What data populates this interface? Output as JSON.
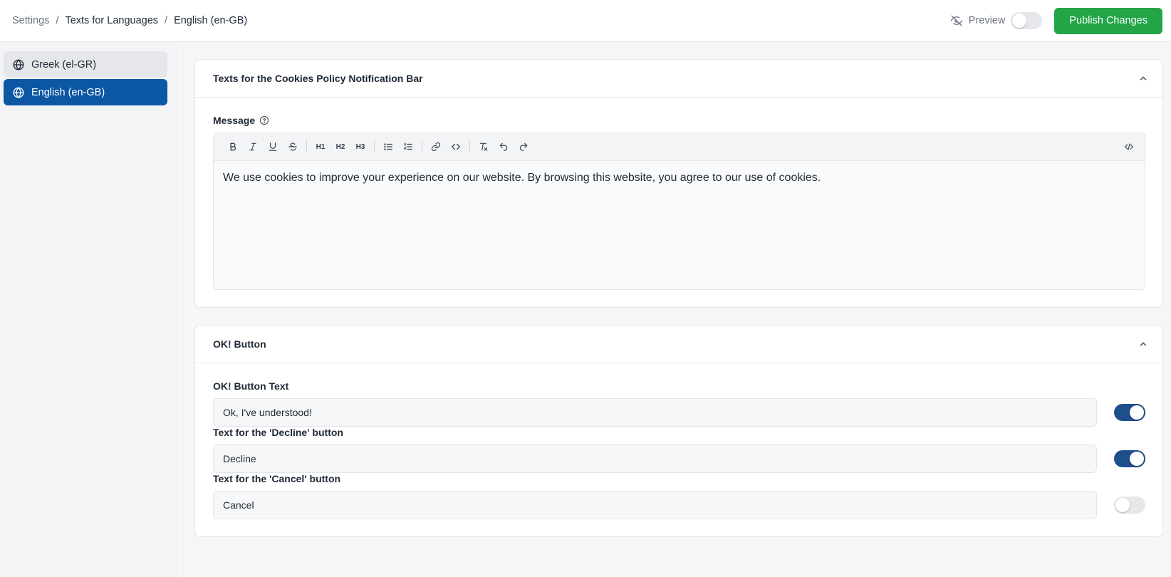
{
  "breadcrumb": {
    "items": [
      "Settings",
      "Texts for Languages",
      "English (en-GB)"
    ],
    "separator": "/"
  },
  "topbar": {
    "preview_label": "Preview",
    "preview_icon": "eye-off-icon",
    "preview_enabled": false,
    "publish_label": "Publish Changes",
    "publish_color": "#22a447"
  },
  "sidebar": {
    "items": [
      {
        "label": "Greek (el-GR)",
        "icon": "globe-icon",
        "active": false
      },
      {
        "label": "English (en-GB)",
        "icon": "globe-icon",
        "active": true
      }
    ],
    "active_color": "#0b57a4"
  },
  "cookies_card": {
    "title": "Texts for the Cookies Policy Notification Bar",
    "message_label": "Message",
    "toolbar": [
      "bold",
      "italic",
      "underline",
      "strikethrough",
      "H1",
      "H2",
      "H3",
      "bullet-list",
      "ordered-list",
      "link",
      "code",
      "clear-format",
      "undo",
      "redo",
      "source-code"
    ],
    "toolbar_heading_labels": {
      "h1": "H1",
      "h2": "H2",
      "h3": "H3"
    },
    "message_text": "We use cookies to improve your experience on our website. By browsing this website, you agree to our use of cookies."
  },
  "ok_card": {
    "title": "OK! Button",
    "fields": [
      {
        "label": "OK! Button Text",
        "value": "Ok, I've understood!",
        "enabled": true
      },
      {
        "label": "Text for the 'Decline' button",
        "value": "Decline",
        "enabled": true
      },
      {
        "label": "Text for the 'Cancel' button",
        "value": "Cancel",
        "enabled": false
      }
    ],
    "toggle_on_color": "#1e4f8c"
  }
}
